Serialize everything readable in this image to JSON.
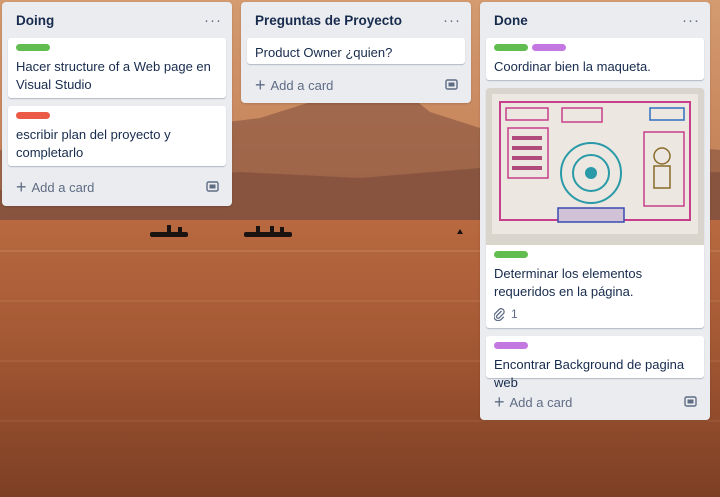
{
  "colors": {
    "green": "#61bd4f",
    "red": "#eb5a46",
    "purple": "#c377e0"
  },
  "lists": [
    {
      "title": "Doing",
      "menu": "···",
      "cards": [
        {
          "labels": [
            "green"
          ],
          "text": "Hacer structure of a Web page en Visual Studio"
        },
        {
          "labels": [
            "red"
          ],
          "text": "escribir plan del proyecto y completarlo"
        }
      ],
      "add_label": "Add a card",
      "template_icon": "card-template-icon"
    },
    {
      "title": "Preguntas de Proyecto",
      "menu": "···",
      "cards": [
        {
          "labels": [],
          "text": "Product Owner ¿quien?"
        }
      ],
      "add_label": "Add a card",
      "template_icon": "card-template-icon"
    },
    {
      "title": "Done",
      "menu": "···",
      "cards": [
        {
          "labels": [
            "green",
            "purple"
          ],
          "text": "Coordinar bien la maqueta."
        },
        {
          "labels": [
            "green"
          ],
          "text": "Determinar los elementos requeridos en la página.",
          "cover": "sketch-photo",
          "attachments": "1"
        },
        {
          "labels": [
            "purple"
          ],
          "text": "Encontrar Background de pagina web"
        }
      ],
      "add_label": "Add a card",
      "template_icon": "card-template-icon"
    }
  ]
}
